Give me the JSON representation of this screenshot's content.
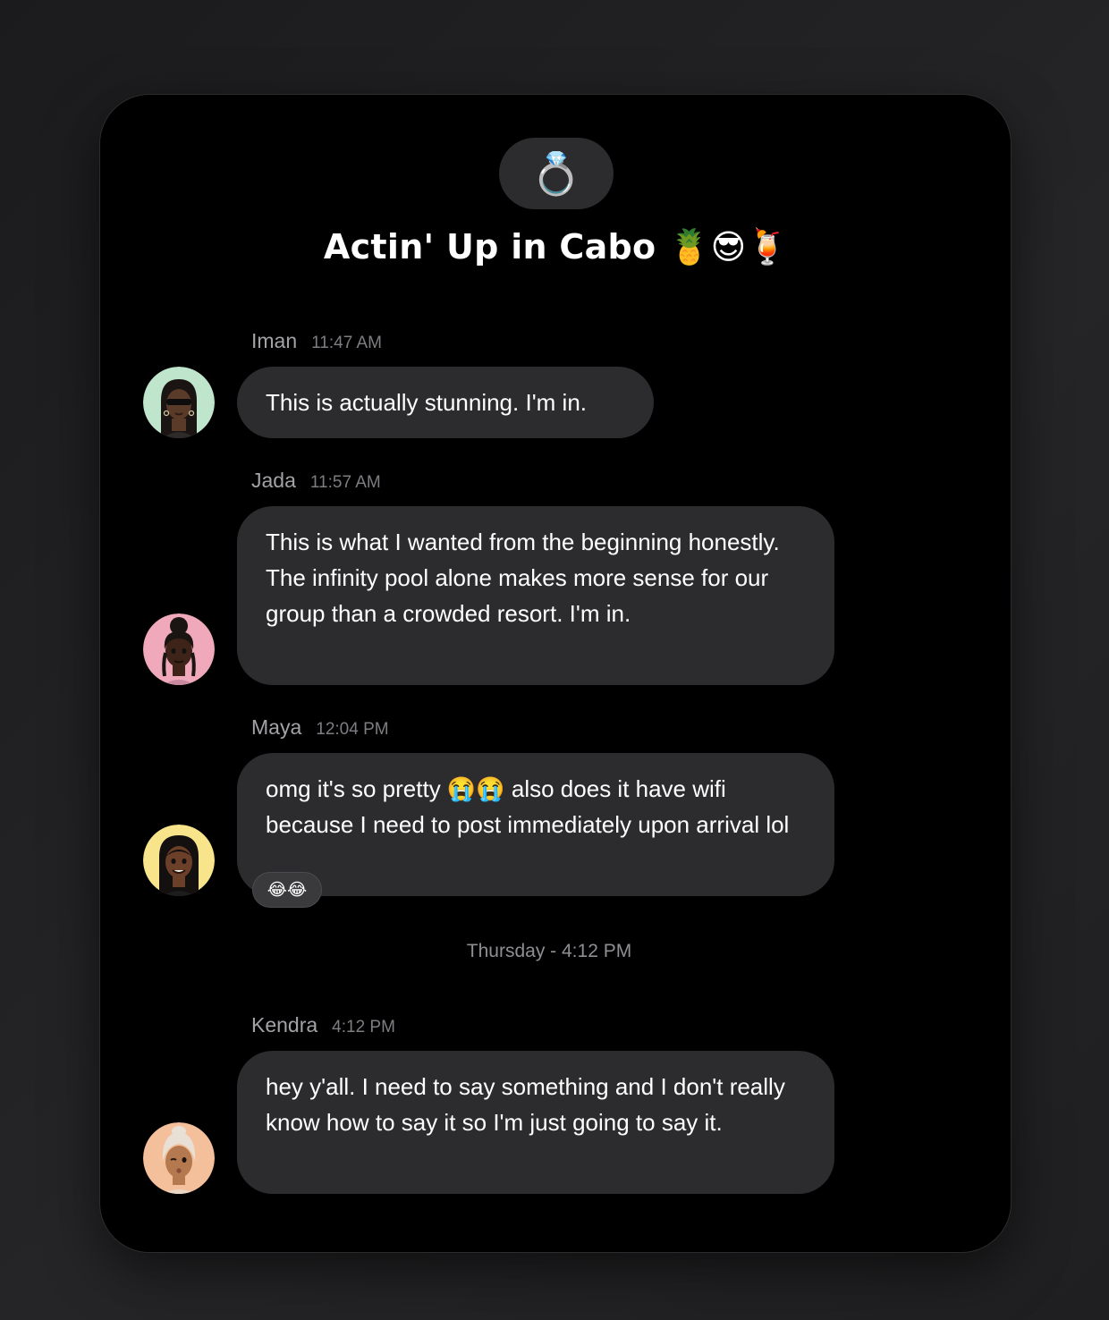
{
  "group": {
    "icon_emoji": "💍",
    "icon_name": "ring-icon",
    "title": "Actin' Up in Cabo 🍍😎🍹"
  },
  "messages": [
    {
      "sender": "Iman",
      "time": "11:47 AM",
      "text": "This is actually stunning. I'm in.",
      "avatar_bg": "#bfe6cd"
    },
    {
      "sender": "Jada",
      "time": "11:57 AM",
      "text": "This is what I wanted from the beginning honestly. The infinity pool alone makes more sense for our group than a crowded resort. I'm in.",
      "avatar_bg": "#f0a9bb"
    },
    {
      "sender": "Maya",
      "time": "12:04 PM",
      "text": "omg it's so pretty 😭😭 also does it have wifi because I need to post immediately upon arrival lol",
      "avatar_bg": "#f7e48b",
      "reaction": "😂😂"
    },
    {
      "sender": "Kendra",
      "time": "4:12 PM",
      "text": "hey y'all. I need to say something and I don't really know how to say it so I'm just going to say it.",
      "avatar_bg": "#f4bf9b"
    }
  ],
  "divider": {
    "label": "Thursday - 4:12 PM"
  },
  "colors": {
    "page_bg": "#1f1f21",
    "card_bg": "#000000",
    "bubble_bg": "#2c2c2e",
    "sender_text": "#a2a2a7",
    "time_text": "#7d7d82"
  }
}
